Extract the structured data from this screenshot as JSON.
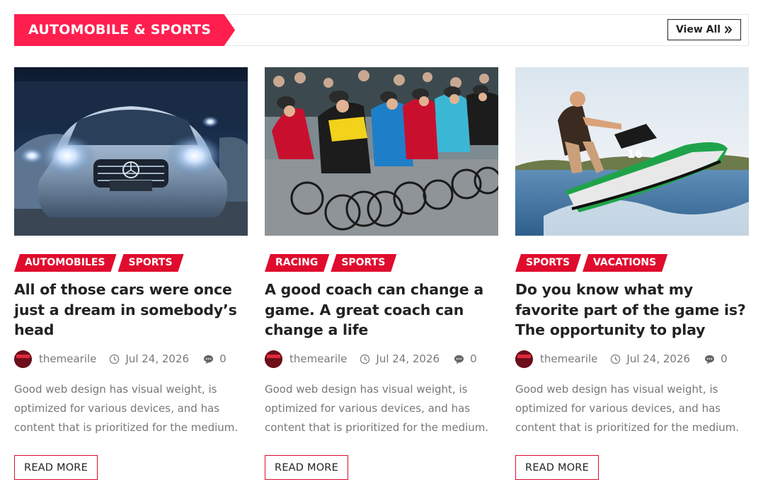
{
  "section": {
    "title": "AUTOMOBILE & SPORTS",
    "view_all_label": "View All",
    "accent_color": "#ff1f4f",
    "category_color": "#e00c2e"
  },
  "posts": [
    {
      "image": "luxury-car-headlights",
      "categories": [
        "AUTOMOBILES",
        "SPORTS"
      ],
      "title": "All of those cars were once just a dream in somebody’s head",
      "author": "themearile",
      "date": "Jul 24, 2026",
      "comments": "0",
      "excerpt": "Good web design has visual weight, is optimized for various devices, and has content that is prioritized for the medium.",
      "read_more": "READ MORE"
    },
    {
      "image": "cycling-race-peloton",
      "categories": [
        "RACING",
        "SPORTS"
      ],
      "title": "A good coach can change a game. A great coach can change a life",
      "author": "themearile",
      "date": "Jul 24, 2026",
      "comments": "0",
      "excerpt": "Good web design has visual weight, is optimized for various devices, and has content that is prioritized for the medium.",
      "read_more": "READ MORE"
    },
    {
      "image": "jet-ski-rider",
      "categories": [
        "SPORTS",
        "VACATIONS"
      ],
      "title": "Do you know what my favorite part of the game is? The opportunity to play",
      "author": "themearile",
      "date": "Jul 24, 2026",
      "comments": "0",
      "excerpt": "Good web design has visual weight, is optimized for various devices, and has content that is prioritized for the medium.",
      "read_more": "READ MORE"
    }
  ]
}
